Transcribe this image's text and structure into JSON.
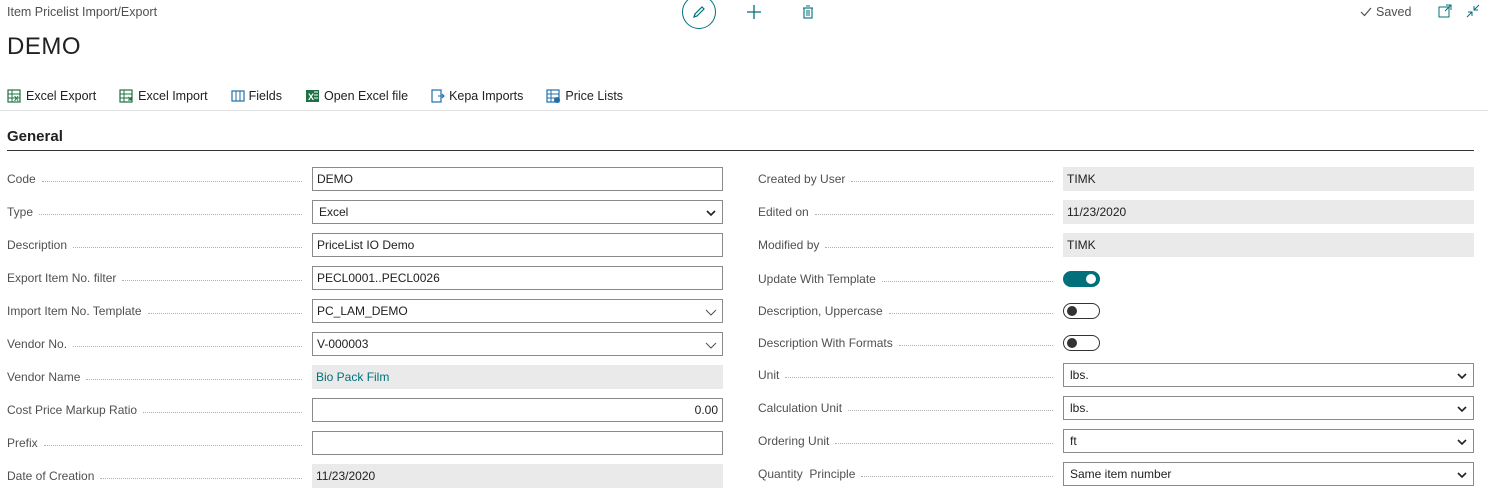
{
  "header": {
    "breadcrumb": "Item Pricelist Import/Export",
    "title": "DEMO",
    "saved_label": "Saved"
  },
  "actions": [
    {
      "label": "Excel Export",
      "icon": "excel-export-icon"
    },
    {
      "label": "Excel Import",
      "icon": "excel-import-icon"
    },
    {
      "label": "Fields",
      "icon": "fields-icon"
    },
    {
      "label": "Open Excel file",
      "icon": "excel-file-icon"
    },
    {
      "label": "Kepa Imports",
      "icon": "kepa-imports-icon"
    },
    {
      "label": "Price Lists",
      "icon": "price-lists-icon"
    }
  ],
  "section": {
    "title": "General"
  },
  "left_fields": {
    "code": {
      "label": "Code",
      "value": "DEMO"
    },
    "type": {
      "label": "Type",
      "value": "Excel"
    },
    "description": {
      "label": "Description",
      "value": "PriceList IO Demo"
    },
    "export_filter": {
      "label": "Export Item No. filter",
      "value": "PECL0001..PECL0026"
    },
    "import_template": {
      "label": "Import Item No. Template",
      "value": "PC_LAM_DEMO"
    },
    "vendor_no": {
      "label": "Vendor No.",
      "value": "V-000003"
    },
    "vendor_name": {
      "label": "Vendor Name",
      "value": "Bio Pack Film"
    },
    "markup": {
      "label": "Cost Price Markup Ratio",
      "value": "0.00"
    },
    "prefix": {
      "label": "Prefix",
      "value": ""
    },
    "date_creation": {
      "label": "Date of Creation",
      "value": "11/23/2020"
    }
  },
  "right_fields": {
    "created_by": {
      "label": "Created by User",
      "value": "TIMK"
    },
    "edited_on": {
      "label": "Edited on",
      "value": "11/23/2020"
    },
    "modified_by": {
      "label": "Modified by",
      "value": "TIMK"
    },
    "update_template": {
      "label": "Update With Template",
      "on": true
    },
    "desc_upper": {
      "label": "Description, Uppercase",
      "on": false
    },
    "desc_formats": {
      "label": "Description With Formats",
      "on": false
    },
    "unit": {
      "label": "Unit",
      "value": "lbs."
    },
    "calc_unit": {
      "label": "Calculation Unit",
      "value": "lbs."
    },
    "ordering_unit": {
      "label": "Ordering Unit",
      "value": "ft"
    },
    "qty_principle": {
      "label": "Quantity  Principle",
      "value": "Same item number"
    }
  },
  "colors": {
    "accent": "#00707a",
    "readonly_bg": "#eaeaea"
  }
}
